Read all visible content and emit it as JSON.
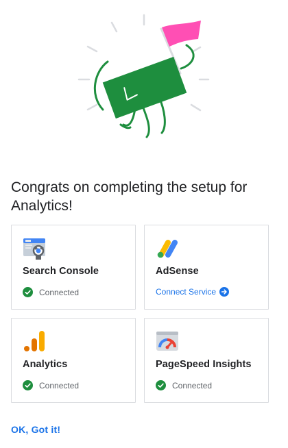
{
  "title": "Congrats on completing the setup for Analytics!",
  "colors": {
    "accent": "#1a73e8",
    "connected": "#1e8e3e",
    "flag": "#ff4fb4",
    "mascot": "#1e8e3e"
  },
  "services": [
    {
      "name": "Search Console",
      "icon": "search-console-icon",
      "status": "Connected"
    },
    {
      "name": "AdSense",
      "icon": "adsense-icon",
      "action": "Connect Service"
    },
    {
      "name": "Analytics",
      "icon": "analytics-icon",
      "status": "Connected"
    },
    {
      "name": "PageSpeed Insights",
      "icon": "pagespeed-insights-icon",
      "status": "Connected"
    }
  ],
  "footer": {
    "ok_label": "OK, Got it!"
  }
}
